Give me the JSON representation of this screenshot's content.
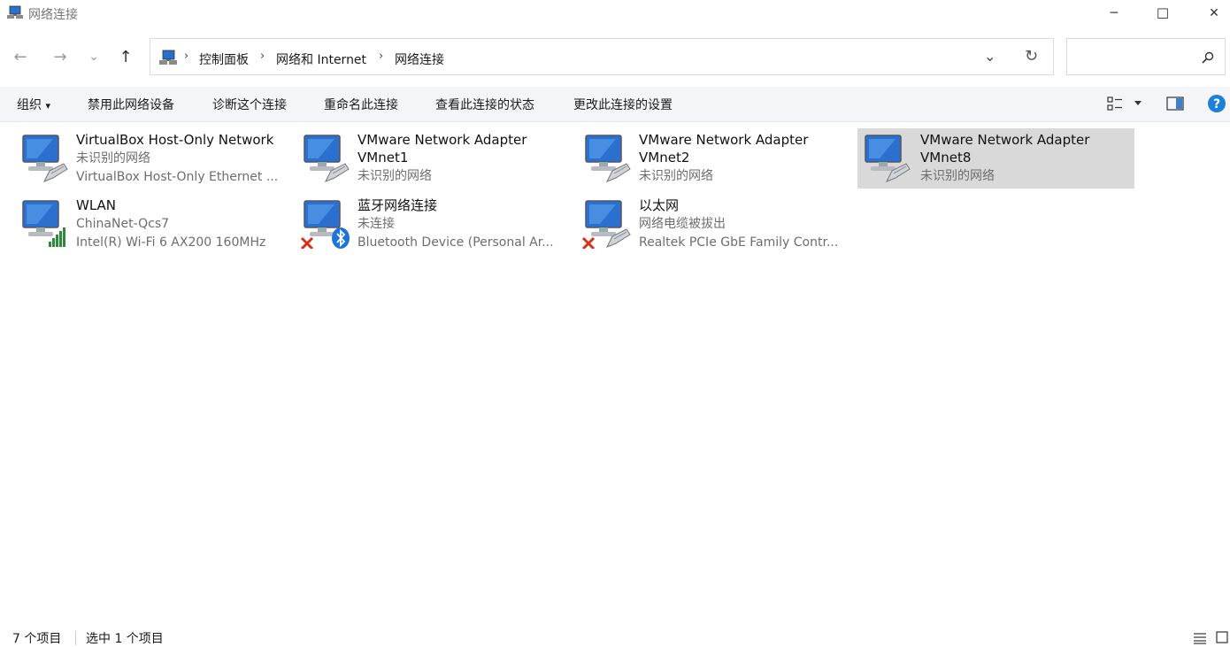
{
  "window": {
    "title": "网络连接",
    "minimize_glyph": "─",
    "maximize_glyph": "☐",
    "close_glyph": "✕"
  },
  "nav": {
    "back_glyph": "←",
    "forward_glyph": "→",
    "recent_glyph": "⌄",
    "up_glyph": "↑"
  },
  "address": {
    "breadcrumbs": [
      "控制面板",
      "网络和 Internet",
      "网络连接"
    ],
    "separator": "›",
    "dropdown_glyph": "⌄",
    "refresh_glyph": "↻"
  },
  "search": {
    "placeholder": "",
    "icon": "search-icon"
  },
  "toolbar": {
    "organize": "组织",
    "organize_arrow": "▾",
    "disable": "禁用此网络设备",
    "diagnose": "诊断这个连接",
    "rename": "重命名此连接",
    "view_status": "查看此连接的状态",
    "change_settings": "更改此连接的设置"
  },
  "connections": [
    {
      "name": "VirtualBox Host-Only Network",
      "line2": "未识别的网络",
      "line3": "VirtualBox Host-Only Ethernet ...",
      "badge": "ethernet-cable-icon",
      "selected": false
    },
    {
      "name": "VMware Network Adapter VMnet1",
      "line2": "未识别的网络",
      "line3": "",
      "badge": "ethernet-cable-icon",
      "selected": false
    },
    {
      "name": "VMware Network Adapter VMnet2",
      "line2": "未识别的网络",
      "line3": "",
      "badge": "ethernet-cable-icon",
      "selected": false
    },
    {
      "name": "VMware Network Adapter VMnet8",
      "line2": "未识别的网络",
      "line3": "",
      "badge": "ethernet-cable-icon",
      "selected": true
    },
    {
      "name": "WLAN",
      "line2": "ChinaNet-Qcs7",
      "line3": "Intel(R) Wi-Fi 6 AX200 160MHz",
      "badge": "wifi-signal-icon",
      "selected": false
    },
    {
      "name": "蓝牙网络连接",
      "line2": "未连接",
      "line3": "Bluetooth Device (Personal Ar...",
      "badge": "bluetooth-icon",
      "selected": false
    },
    {
      "name": "以太网",
      "line2": "网络电缆被拔出",
      "line3": "Realtek PCIe GbE Family Contr...",
      "badge": "ethernet-cable-icon",
      "selected": false
    }
  ],
  "statusbar": {
    "count": "7 个项目",
    "selected": "选中 1 个项目"
  },
  "colors": {
    "accent": "#0078d7",
    "help": "#1e7fd8",
    "error_x": "#d9301a",
    "wifi_bars": "#2e8b3a",
    "selection": "#d9d9d9"
  }
}
